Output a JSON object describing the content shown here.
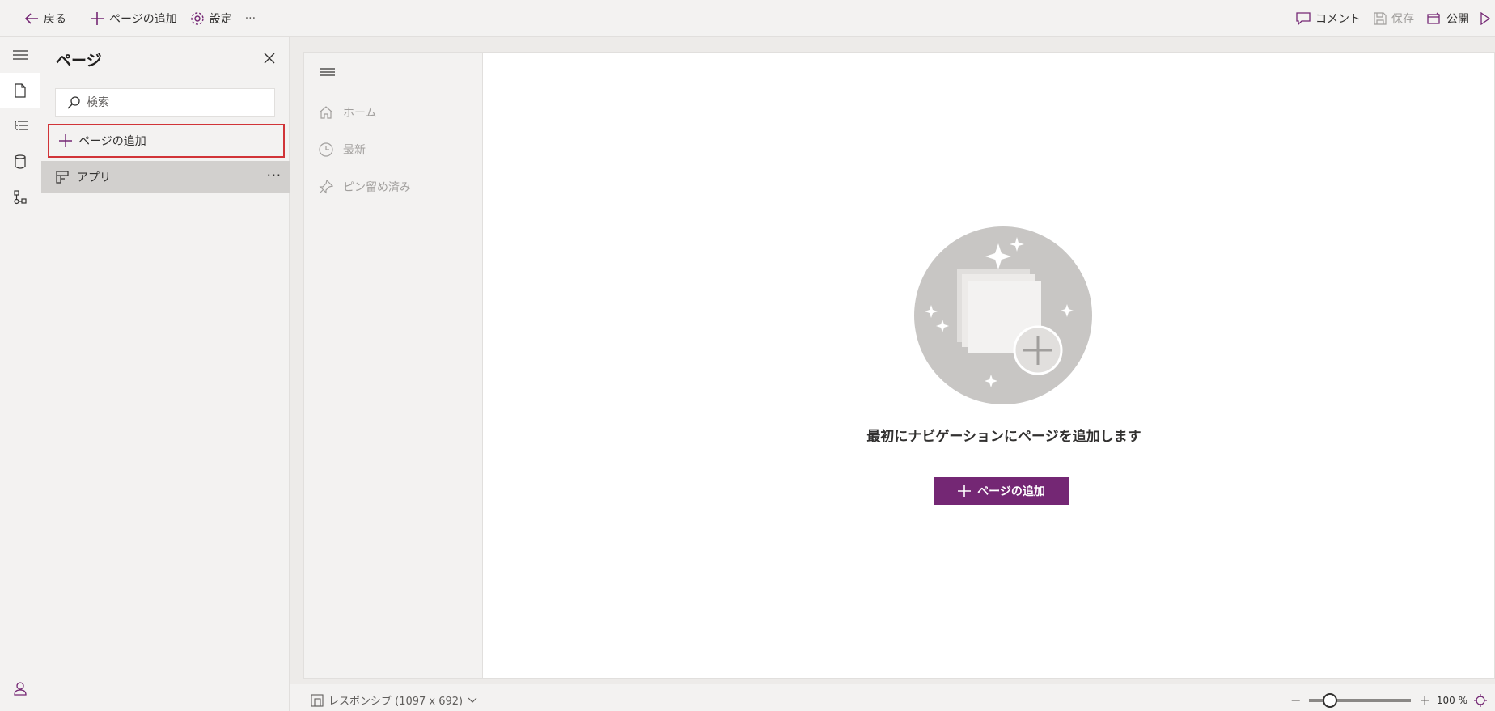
{
  "toolbar": {
    "back_label": "戻る",
    "add_page_label": "ページの追加",
    "settings_label": "設定",
    "more_label": "···",
    "comment_label": "コメント",
    "save_label": "保存",
    "publish_label": "公開"
  },
  "panel": {
    "title": "ページ",
    "search_placeholder": "検索",
    "add_page_label": "ページの追加",
    "items": [
      {
        "label": "アプリ",
        "more": "···"
      }
    ]
  },
  "app_nav": {
    "items": [
      {
        "label": "ホーム",
        "icon": "home-icon"
      },
      {
        "label": "最新",
        "icon": "clock-icon"
      },
      {
        "label": "ピン留め済み",
        "icon": "pin-icon"
      }
    ]
  },
  "empty_state": {
    "title": "最初にナビゲーションにページを追加します",
    "button_label": "ページの追加"
  },
  "statusbar": {
    "layout_label": "レスポンシブ (1097 x 692)",
    "zoom_value": "100 %",
    "zoom_minus": "−",
    "zoom_plus": "+",
    "zoom_fraction": 0.2
  },
  "colors": {
    "accent": "#742774",
    "highlight_border": "#d13438",
    "selected_item": "#d2d0ce"
  }
}
